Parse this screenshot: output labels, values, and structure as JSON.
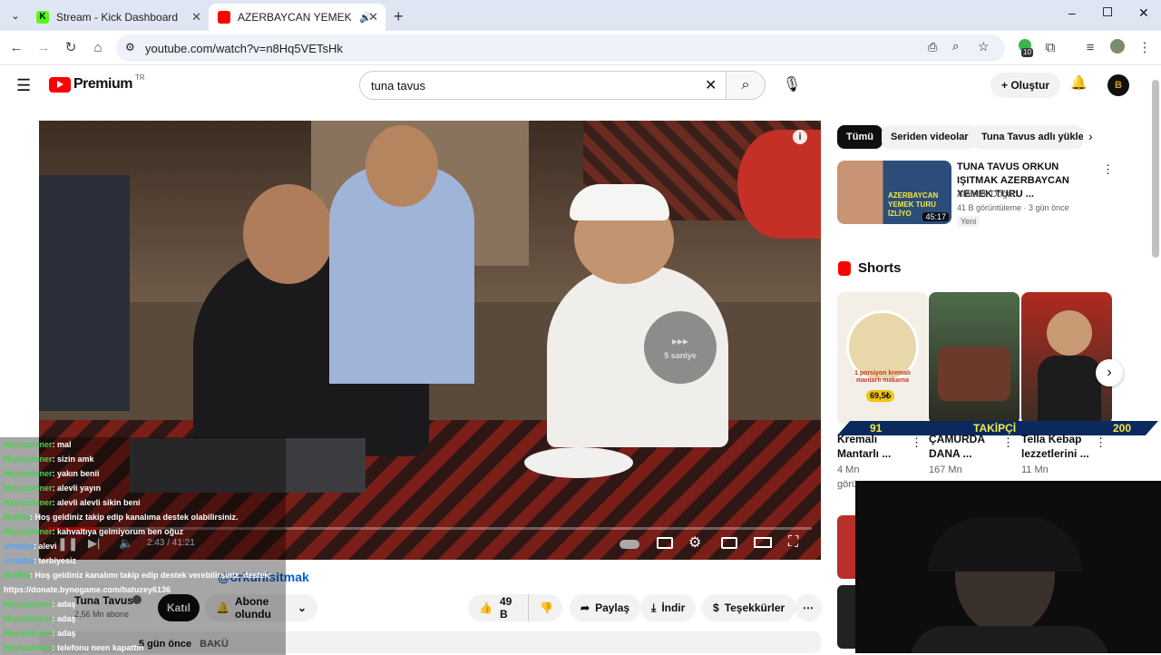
{
  "tabs": [
    {
      "title": "Stream - Kick Dashboard",
      "favicon_color": "#53fc18"
    },
    {
      "title": "AZERBAYCAN YEMEK TURU",
      "favicon_color": "#ff0000"
    }
  ],
  "browser": {
    "url": "youtube.com/watch?v=n8Hq5VETsHk",
    "extension_badge": "10"
  },
  "yt": {
    "logo_text": "Premium",
    "logo_region": "TR",
    "search_value": "tuna tavus",
    "create_label": "Oluştur"
  },
  "player": {
    "time": "2:43 / 41:21",
    "next_label": "5 saniye"
  },
  "channel": {
    "title_fragment": "@orkunisitmak",
    "name": "Tuna Tavus",
    "subs": "2,56 Mn abone",
    "join_label": "Katıl",
    "subscribed_label": "Abone olundu",
    "likes": "49 B",
    "share_label": "Paylaş",
    "download_label": "İndir",
    "thanks_label": "Teşekkürler",
    "date": "5 gün önce",
    "location": "BAKÜ"
  },
  "chat": [
    {
      "user": "Haylazdoner",
      "msg": ": mal",
      "cls": "user"
    },
    {
      "user": "Haylazdoner",
      "msg": ": sizin amk",
      "cls": "user"
    },
    {
      "user": "Haylazdoner",
      "msg": ": yakın benii",
      "cls": "user"
    },
    {
      "user": "Haylazdoner",
      "msg": ": alevli yayın",
      "cls": "user"
    },
    {
      "user": "Haylazdoner",
      "msg": ": alevli alevli sikin beni",
      "cls": "user"
    },
    {
      "user": "BotRix",
      "msg": ": Hoş geldiniz takip edip kanalıma destek olabilirsiniz.",
      "cls": "user"
    },
    {
      "user": "Haylazdoner",
      "msg": ": kahvaltıya gelmiyorum ben oğuz",
      "cls": "user"
    },
    {
      "user": "utrabba",
      "msg": ": alevi",
      "cls": "user2"
    },
    {
      "user": "utrabba",
      "msg": ": terbiyesiz",
      "cls": "user2"
    },
    {
      "user": "BotRix",
      "msg": ": Hoş geldiniz kanalımı takip edip destek verebilirsiniz. destek:",
      "cls": "user"
    },
    {
      "user": "",
      "msg": "https://donate.bynogame.com/batuzey6136",
      "cls": "user"
    },
    {
      "user": "Haylazdoner",
      "msg": ": adaş",
      "cls": "user"
    },
    {
      "user": "Haylazdoner",
      "msg": ": adaş",
      "cls": "user"
    },
    {
      "user": "Haylazdoner",
      "msg": ": adaş",
      "cls": "user"
    },
    {
      "user": "Haylazdoner",
      "msg": ": telefonu neen kapattın",
      "cls": "user"
    }
  ],
  "sidebar": {
    "chips": [
      "Tümü",
      "Seriden videolar",
      "Tuna Tavus adlı yükle"
    ],
    "rec": {
      "title": "TUNA TAVUS ORKUN IŞITMAK AZERBAYCAN YEMEK TURU ...",
      "channel": "Ataberk Doğan",
      "meta": "41 B görüntüleme · 3 gün önce",
      "badge": "Yeni",
      "duration": "45:17",
      "thumb_text": "AZERBAYCAN YEMEK TURU İZLİYO"
    },
    "shorts_label": "Shorts",
    "shorts": [
      {
        "title": "Kremalı Mantarlı ...",
        "views": "4 Mn",
        "views2": "görü...",
        "overlay": "1 porsiyon kremalı mantarlı makarna",
        "price": "69,5₺"
      },
      {
        "title": "ÇAMURDA DANA ...",
        "views": "167 Mn"
      },
      {
        "title": "Tella Kebap lezzetlerini ...",
        "views": "11 Mn"
      }
    ],
    "follower_bar": {
      "left": "91",
      "mid": "TAKİPÇİ",
      "right": "200"
    }
  }
}
